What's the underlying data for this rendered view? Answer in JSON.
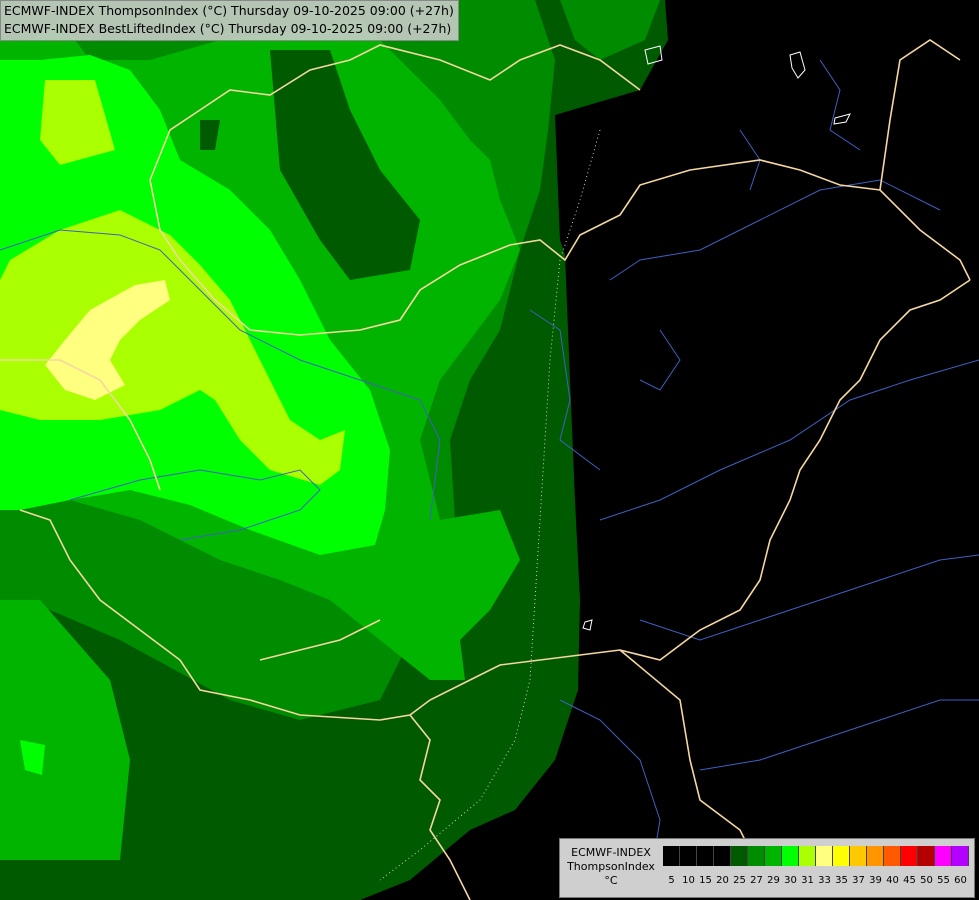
{
  "header": {
    "title_line1": "ECMWF-INDEX ThompsonIndex (°C) Thursday 09-10-2025 09:00 (+27h)",
    "title_line2": "ECMWF-INDEX BestLiftedIndex (°C) Thursday 09-10-2025 09:00 (+27h)"
  },
  "legend": {
    "model": "ECMWF-INDEX",
    "parameter": "ThompsonIndex",
    "unit": "°C",
    "classes": [
      {
        "label": "5",
        "color": "#000000"
      },
      {
        "label": "10",
        "color": "#000000"
      },
      {
        "label": "15",
        "color": "#000000"
      },
      {
        "label": "20",
        "color": "#000000"
      },
      {
        "label": "25",
        "color": "#005a00"
      },
      {
        "label": "27",
        "color": "#008c00"
      },
      {
        "label": "29",
        "color": "#00b400"
      },
      {
        "label": "30",
        "color": "#00ff00"
      },
      {
        "label": "31",
        "color": "#aaff00"
      },
      {
        "label": "33",
        "color": "#ffff80"
      },
      {
        "label": "35",
        "color": "#ffff00"
      },
      {
        "label": "37",
        "color": "#ffc800"
      },
      {
        "label": "39",
        "color": "#ff9600"
      },
      {
        "label": "40",
        "color": "#ff5a00"
      },
      {
        "label": "45",
        "color": "#ff0000"
      },
      {
        "label": "50",
        "color": "#b40000"
      },
      {
        "label": "55",
        "color": "#ff00ff"
      },
      {
        "label": "60",
        "color": "#b400ff"
      }
    ]
  },
  "colors": {
    "background": "#000000",
    "border": "#f5d7a0",
    "river": "#4060c0"
  }
}
